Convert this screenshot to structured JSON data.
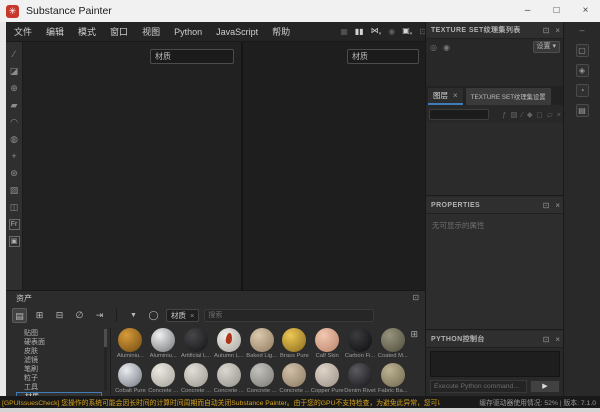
{
  "window": {
    "title": "Substance Painter",
    "minimize": "–",
    "maximize": "□",
    "close": "×"
  },
  "menu": {
    "items": [
      "文件",
      "编辑",
      "模式",
      "窗口",
      "视图",
      "Python",
      "JavaScript",
      "帮助"
    ]
  },
  "viewport_toolbar": {
    "icons": [
      {
        "name": "bake-icon",
        "glyph": "▦",
        "dim": true
      },
      {
        "name": "pause-icon",
        "glyph": "▮▮",
        "dim": false
      },
      {
        "name": "mixer-dropdown-icon",
        "glyph": "⋈",
        "caret": true,
        "dim": false
      },
      {
        "name": "record-icon",
        "glyph": "◉",
        "dim": true
      },
      {
        "name": "camera-dropdown-icon",
        "glyph": "▣",
        "caret": true,
        "dim": false
      },
      {
        "name": "screenshot-icon",
        "glyph": "⊡",
        "dim": true
      }
    ]
  },
  "left_toolbar": {
    "icons": [
      {
        "name": "brush-tool-icon",
        "glyph": "∕"
      },
      {
        "name": "eraser-tool-icon",
        "glyph": "◪"
      },
      {
        "name": "projection-tool-icon",
        "glyph": "⊕"
      },
      {
        "name": "polygon-fill-tool-icon",
        "glyph": "▰"
      },
      {
        "name": "smudge-tool-icon",
        "glyph": "◠"
      },
      {
        "name": "clone-tool-icon",
        "glyph": "◍"
      },
      {
        "name": "material-picker-tool-icon",
        "glyph": "+"
      },
      {
        "name": "particles-tool-icon",
        "glyph": "⊛"
      },
      {
        "name": "quick-mask-icon",
        "glyph": "▨"
      },
      {
        "name": "symmetry-icon",
        "glyph": "◫"
      },
      {
        "name": "frame-tool-icon",
        "glyph": "Fr",
        "boxed": true
      },
      {
        "name": "note-tool-icon",
        "glyph": "▣",
        "boxed": true
      }
    ]
  },
  "viewports": {
    "left_mode": "材质",
    "right_mode": "材质"
  },
  "right_strip": {
    "collapse_glyph": "‒",
    "icons": [
      {
        "name": "display-settings-icon",
        "glyph": "▢"
      },
      {
        "name": "shader-settings-icon",
        "glyph": "◈"
      },
      {
        "name": "history-icon",
        "glyph": "◔"
      },
      {
        "name": "log-icon",
        "glyph": "▤"
      }
    ]
  },
  "texture_set_list": {
    "title": "TEXTURE SET纹理集列表",
    "popout_glyph": "⊡",
    "close_glyph": "×",
    "icons": [
      {
        "name": "link-icon",
        "glyph": "◎"
      },
      {
        "name": "visibility-icon",
        "glyph": "◉"
      }
    ],
    "dropdown_label": "设置",
    "dropdown_caret": "▾"
  },
  "tabs": {
    "layers_label": "图层",
    "layers_close": "×",
    "settings_label": "TEXTURE SET纹理集设置"
  },
  "layers_panel": {
    "search_value": "",
    "toolbar_icons": [
      {
        "name": "add-effect-icon",
        "glyph": "ƒ"
      },
      {
        "name": "add-fill-layer-icon",
        "glyph": "▧"
      },
      {
        "name": "add-paint-layer-icon",
        "glyph": "∕"
      },
      {
        "name": "add-smart-material-icon",
        "glyph": "◆"
      },
      {
        "name": "add-mask-icon",
        "glyph": "◻"
      },
      {
        "name": "add-folder-icon",
        "glyph": "▱"
      },
      {
        "name": "delete-layer-icon",
        "glyph": "×"
      }
    ]
  },
  "properties": {
    "title": "PROPERTIES",
    "popout_glyph": "⊡",
    "close_glyph": "×",
    "empty_text": "无可显示的属性"
  },
  "python_console": {
    "title": "PYTHON控制台",
    "popout_glyph": "⊡",
    "close_glyph": "×",
    "input_placeholder": "Execute Python command...",
    "run_glyph": "▶"
  },
  "assets": {
    "title": "资产",
    "popout_glyph": "⊡",
    "toolbar_icons": [
      {
        "name": "folder-icon",
        "glyph": "▤",
        "active": true
      },
      {
        "name": "add-shelf-icon",
        "glyph": "⊞"
      },
      {
        "name": "save-shelf-icon",
        "glyph": "⊟"
      },
      {
        "name": "hide-assets-icon",
        "glyph": "∅"
      },
      {
        "name": "import-assets-icon",
        "glyph": "⇥"
      }
    ],
    "filter_icon": "▼",
    "shape_icon": "◯",
    "filter_tab": {
      "label": "材质",
      "close": "×"
    },
    "search_placeholder": "搜索",
    "grid_icon": "⊞",
    "categories": [
      {
        "label": "贴图"
      },
      {
        "label": "硬表面"
      },
      {
        "label": "皮肤"
      },
      {
        "label": "滤镜"
      },
      {
        "label": "笔刷"
      },
      {
        "label": "粒子"
      },
      {
        "label": "工具"
      },
      {
        "label": "材质",
        "selected": true
      }
    ],
    "materials": [
      {
        "name": "Aluminiu...",
        "c1": "#d89a3a",
        "c2": "#6e4a10"
      },
      {
        "name": "Aluminiu...",
        "c1": "#f0f0f0",
        "c2": "#6f7377"
      },
      {
        "name": "Artificial L...",
        "c1": "#47474b",
        "c2": "#121214"
      },
      {
        "name": "Autumn L...",
        "c1": "#efede8",
        "c2": "#a9a69e",
        "leaf": true
      },
      {
        "name": "Baked Lig...",
        "c1": "#dcc9ae",
        "c2": "#8f7a5e"
      },
      {
        "name": "Brass Pure",
        "c1": "#ecc854",
        "c2": "#8a681b"
      },
      {
        "name": "Calf Skin",
        "c1": "#f2c7b0",
        "c2": "#b98368"
      },
      {
        "name": "Carbon Fi...",
        "c1": "#3c3c40",
        "c2": "#0c0c0e"
      },
      {
        "name": "Coated M...",
        "c1": "#97937d",
        "c2": "#4e4c3a"
      },
      {
        "name": "Cobalt Pure",
        "c1": "#e9ecf0",
        "c2": "#70767e"
      },
      {
        "name": "Concrete ...",
        "c1": "#ece9e3",
        "c2": "#a3a099"
      },
      {
        "name": "Concrete ...",
        "c1": "#e2dfd8",
        "c2": "#99968e"
      },
      {
        "name": "Concrete ...",
        "c1": "#dbd8d1",
        "c2": "#92908a"
      },
      {
        "name": "Concrete ...",
        "c1": "#c4c2bc",
        "c2": "#7b7974"
      },
      {
        "name": "Concrete ...",
        "c1": "#d2c0a8",
        "c2": "#8a7962"
      },
      {
        "name": "Copper Pure",
        "c1": "#e0d4c8",
        "c2": "#9a9086"
      },
      {
        "name": "Denim Rivet",
        "c1": "#5a5a60",
        "c2": "#141418"
      },
      {
        "name": "Fabric Ba...",
        "c1": "#bdb293",
        "c2": "#6f684f"
      }
    ]
  },
  "status_bar": {
    "warning": "[GPUIssuesCheck] 您操作的系统可能会因长时间的计算时间周期而自动关闭Substance Painter。由于您的GPU不支持检查，为避免此异常，您可以尝试增加TDR（超时检…",
    "cache_usage": "缓存驱动器使用情况: 52%",
    "divider": "|",
    "version": "版本: 7.1.0"
  },
  "colors": {
    "accent": "#3e7db8",
    "warning_text": "#d7a31d",
    "titlebar_bg": "#f1f1f1",
    "panel_bg": "#2a2a2a"
  }
}
